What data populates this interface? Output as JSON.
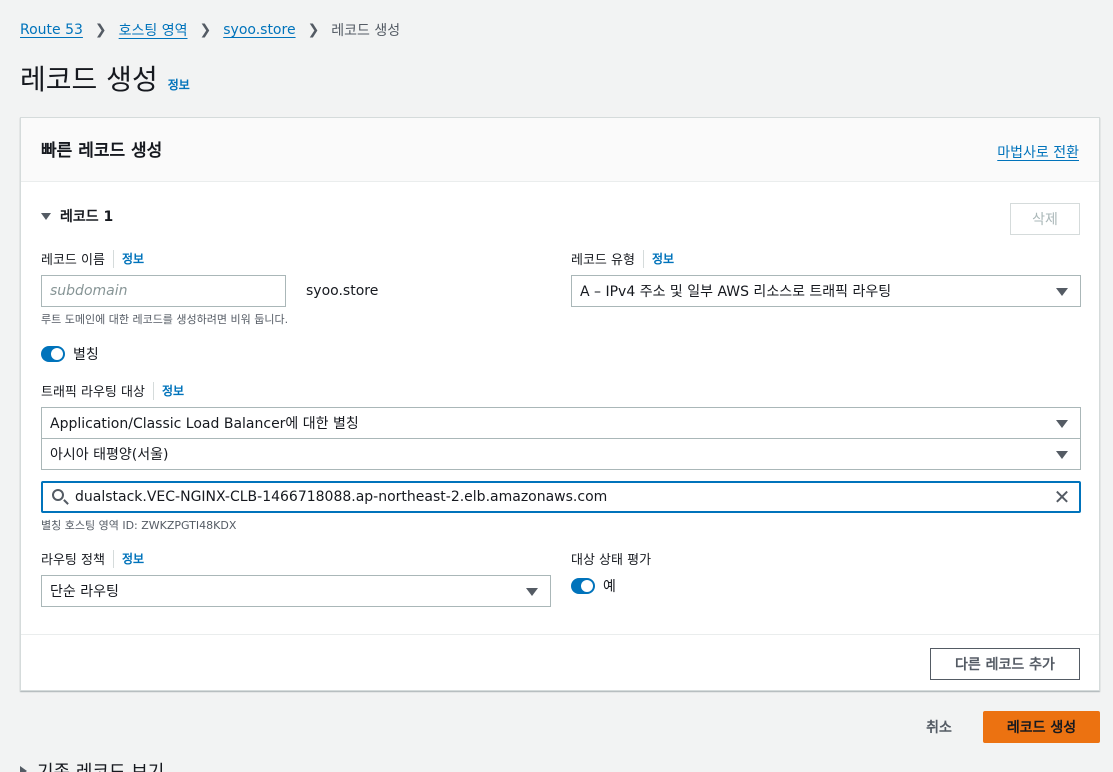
{
  "breadcrumb": {
    "items": [
      "Route 53",
      "호스팅 영역",
      "syoo.store"
    ],
    "current": "레코드 생성"
  },
  "page": {
    "title": "레코드 생성",
    "info": "정보"
  },
  "panel": {
    "title": "빠른 레코드 생성",
    "wizard_link": "마법사로 전환",
    "record_header": "레코드 1",
    "delete_button": "삭제",
    "record_name": {
      "label": "레코드 이름",
      "info": "정보",
      "placeholder": "subdomain",
      "domain_suffix": "syoo.store",
      "help": "루트 도메인에 대한 레코드를 생성하려면 비워 둡니다."
    },
    "record_type": {
      "label": "레코드 유형",
      "info": "정보",
      "value": "A – IPv4 주소 및 일부 AWS 리소스로 트래픽 라우팅"
    },
    "alias": {
      "label": "별칭",
      "enabled": true
    },
    "traffic_target": {
      "label": "트래픽 라우팅 대상",
      "info": "정보",
      "endpoint_type": "Application/Classic Load Balancer에 대한 별칭",
      "region": "아시아 태평양(서울)",
      "load_balancer": "dualstack.VEC-NGINX-CLB-1466718088.ap-northeast-2.elb.amazonaws.com",
      "hosted_zone_help": "별칭 호스팅 영역 ID: ZWKZPGTI48KDX"
    },
    "routing_policy": {
      "label": "라우팅 정책",
      "info": "정보",
      "value": "단순 라우팅"
    },
    "health": {
      "label": "대상 상태 평가",
      "toggle_label": "예",
      "enabled": true
    },
    "add_record_button": "다른 레코드 추가"
  },
  "actions": {
    "cancel": "취소",
    "create": "레코드 생성"
  },
  "below_fold": {
    "section_title": "기존 레코드 보기"
  },
  "colors": {
    "link": "#0073bb",
    "primary": "#ec7211",
    "toggle_on": "#0073bb"
  }
}
